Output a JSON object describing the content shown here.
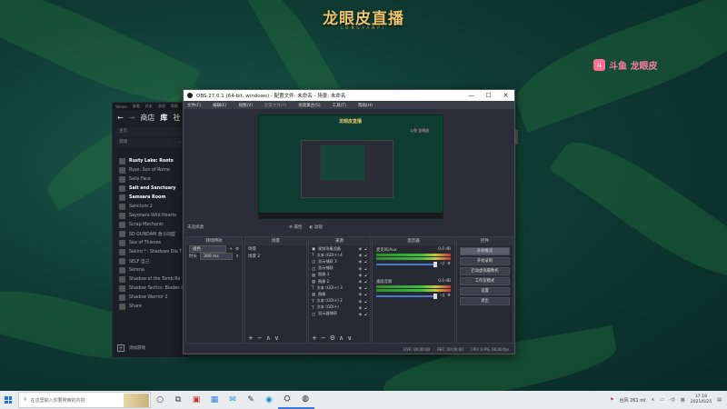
{
  "overlay": {
    "title": "龙眼皮直播",
    "subtitle": "LONGYANPI",
    "platform_logo": "斗",
    "platform_text": "斗鱼 龙眼皮"
  },
  "steam": {
    "top_menu": [
      "Steam",
      "查看",
      "好友",
      "游戏",
      "帮助"
    ],
    "nav": {
      "back": "←",
      "forward": "→",
      "store": "商店",
      "library": "库",
      "community": "社"
    },
    "home": "主页",
    "filter": "游戏",
    "games": [
      {
        "name": "Rusty Lake: Roots",
        "bold": true
      },
      {
        "name": "Ryse: Son of Rome",
        "bold": false
      },
      {
        "name": "Sally Face",
        "bold": false
      },
      {
        "name": "Salt and Sanctuary",
        "bold": true
      },
      {
        "name": "Samsara Room",
        "bold": true
      },
      {
        "name": "Sanctum 2",
        "bold": false
      },
      {
        "name": "Sayonara Wild Hearts",
        "bold": false
      },
      {
        "name": "Scrap Mechanic",
        "bold": false
      },
      {
        "name": "SD GUNDAM 激斗同盟",
        "bold": false
      },
      {
        "name": "Sea of Thieves",
        "bold": false
      },
      {
        "name": "Sekiro™: Shadows Die T",
        "bold": false
      },
      {
        "name": "SELF 自己",
        "bold": false
      },
      {
        "name": "Serena",
        "bold": false
      },
      {
        "name": "Shadow of the Tomb Ra",
        "bold": false
      },
      {
        "name": "Shadow Tactics: Blades o",
        "bold": false
      },
      {
        "name": "Shadow Warrior 2",
        "bold": false
      },
      {
        "name": "Share",
        "bold": false
      }
    ],
    "add_game": "添加游戏",
    "add_icon": "+"
  },
  "obs": {
    "title": "OBS 27.0.1 (64-bit, windows) - 配置文件: 未命名 - 场景: 未命名",
    "controls": {
      "min": "—",
      "max": "☐",
      "close": "✕"
    },
    "menu": [
      "文件(F)",
      "编辑(E)",
      "视图(V)",
      "配置文件(P)",
      "场景集合(S)",
      "工具(T)",
      "帮助(H)"
    ],
    "preview": {
      "t1": "龙眼皮直播",
      "t2": "斗鱼 龙眼皮"
    },
    "no_source": "未选择源",
    "props_label": "属性",
    "filters_label": "滤镜",
    "docks": {
      "transitions": {
        "header": "转场特效",
        "type": "褪色",
        "duration_label": "时长",
        "duration_value": "300 ms"
      },
      "scenes": {
        "header": "场景",
        "items": [
          "场景",
          "场景 2"
        ]
      },
      "sources": {
        "header": "来源",
        "items": [
          {
            "icon": "▣",
            "name": "视频采集设备"
          },
          {
            "icon": "T",
            "name": "文本 (GDI+) 4"
          },
          {
            "icon": "◫",
            "name": "显示捕获 3"
          },
          {
            "icon": "◫",
            "name": "显示捕获"
          },
          {
            "icon": "▨",
            "name": "图像 3"
          },
          {
            "icon": "▨",
            "name": "图像 2"
          },
          {
            "icon": "T",
            "name": "文本 (GDI+) 3"
          },
          {
            "icon": "▨",
            "name": "图像"
          },
          {
            "icon": "T",
            "name": "文本 (GDI+) 2"
          },
          {
            "icon": "T",
            "name": "文本 (GDI+)"
          },
          {
            "icon": "◫",
            "name": "显示器捕获"
          }
        ]
      },
      "mixer": {
        "header": "混音器",
        "tracks": [
          {
            "name": "麦克风/Aux",
            "level": "0.0 dB"
          },
          {
            "name": "桌面音频",
            "level": "0.0 dB"
          }
        ]
      },
      "controls": {
        "header": "控件",
        "buttons": [
          "开始推流",
          "开始录制",
          "启动虚拟摄像机",
          "工作室模式",
          "设置",
          "退出"
        ]
      }
    },
    "status": {
      "live": "LIVE: 00:00:00",
      "rec": "REC: 00:00:00",
      "cpu": "CPU: 0.9%, 60.00 fps"
    }
  },
  "taskbar": {
    "search_placeholder": "在这里输入你要搜索的内容",
    "weather": "台风 261 ml",
    "lang": "英",
    "time": "17:18",
    "date": "2021/6/25"
  }
}
